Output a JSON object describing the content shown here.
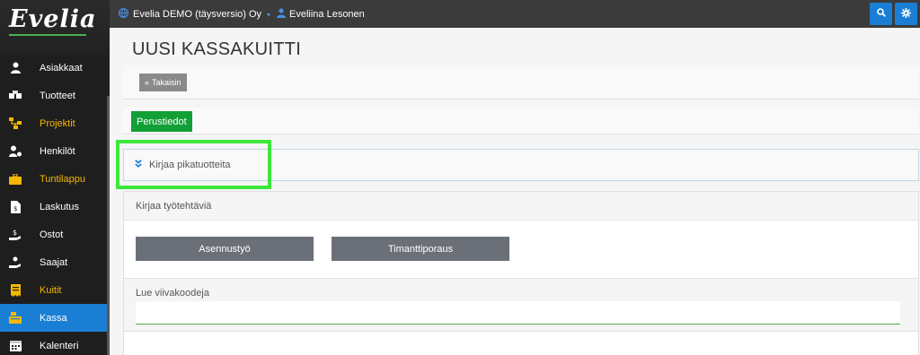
{
  "app": {
    "logo_text": "Evelia"
  },
  "sidebar": {
    "items": [
      {
        "label": "Asiakkaat",
        "icon": "user-icon"
      },
      {
        "label": "Tuotteet",
        "icon": "boxes-icon"
      },
      {
        "label": "Projektit",
        "icon": "sitemap-icon",
        "highlight": true
      },
      {
        "label": "Henkilöt",
        "icon": "user-gear-icon"
      },
      {
        "label": "Tuntilappu",
        "icon": "briefcase-clock-icon",
        "highlight": true
      },
      {
        "label": "Laskutus",
        "icon": "invoice-icon"
      },
      {
        "label": "Ostot",
        "icon": "hand-dollar-icon"
      },
      {
        "label": "Saajat",
        "icon": "hand-receive-icon"
      },
      {
        "label": "Kuitit",
        "icon": "receipt-icon",
        "highlight": true
      },
      {
        "label": "Kassa",
        "icon": "cash-register-icon",
        "active": true
      },
      {
        "label": "Kalenteri",
        "icon": "calendar-icon"
      }
    ]
  },
  "topbar": {
    "company": "Evelia DEMO (täysversio) Oy",
    "user": "Eveliina Lesonen",
    "search_icon": "search-icon",
    "settings_icon": "gear-icon"
  },
  "main": {
    "title": "UUSI KASSAKUITTI",
    "back_button": "Takaisin",
    "tab_label": "Perustiedot",
    "quick_products_label": "Kirjaa pikatuotteita",
    "tasks": {
      "title": "Kirjaa työtehtäviä",
      "buttons": [
        "Asennustyö",
        "Timanttiporaus"
      ]
    },
    "barcode": {
      "title": "Lue viivakoodeja",
      "value": ""
    }
  },
  "colors": {
    "accent": "#1a7fd4",
    "success": "#12a036",
    "highlight_outline": "#3ee63a",
    "sidebar_highlight": "#f5b800"
  }
}
